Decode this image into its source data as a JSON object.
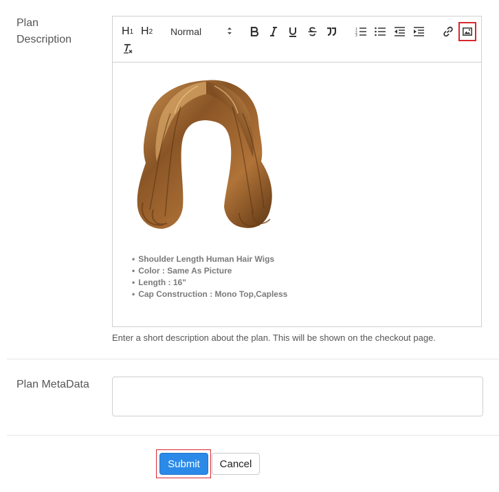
{
  "labels": {
    "plan_description": "Plan Description",
    "plan_metadata": "Plan MetaData"
  },
  "toolbar": {
    "h1": "H1",
    "h2": "H2",
    "format_select": "Normal"
  },
  "editor": {
    "bullets": [
      "Shoulder Length Human Hair Wigs",
      "Color : Same As Picture",
      "Length : 16\"",
      "Cap Construction : Mono Top,Capless"
    ]
  },
  "help_text": "Enter a short description about the plan. This will be shown on the checkout page.",
  "metadata_input": {
    "value": ""
  },
  "buttons": {
    "submit": "Submit",
    "cancel": "Cancel"
  },
  "colors": {
    "primary": "#2b8ae8",
    "highlight": "#d9262e",
    "border": "#cfcfcf"
  }
}
